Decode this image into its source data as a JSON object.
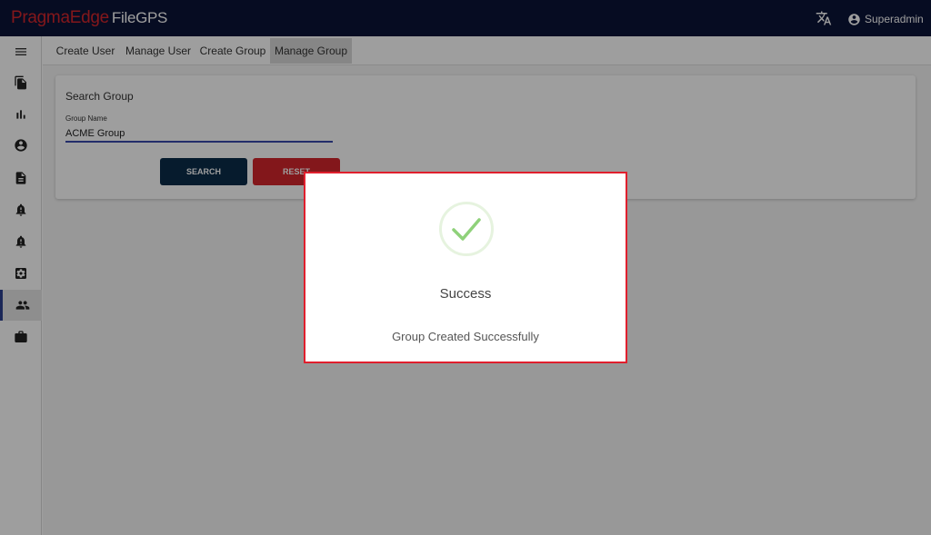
{
  "header": {
    "logo_brand": "PragmaEdge",
    "logo_product": "FileGPS",
    "translate_icon": "translate-icon",
    "user_icon": "account-circle-icon",
    "username": "Superadmin",
    "background": "#0b1437",
    "brand_color": "#d4262c"
  },
  "sidebar": {
    "items": [
      {
        "icon": "menu-icon",
        "active": false
      },
      {
        "icon": "files-icon",
        "active": false
      },
      {
        "icon": "bar-chart-icon",
        "active": false
      },
      {
        "icon": "account-circle-icon",
        "active": false
      },
      {
        "icon": "document-icon",
        "active": false
      },
      {
        "icon": "bell-alert-icon",
        "active": false
      },
      {
        "icon": "bell-alert-icon",
        "active": false
      },
      {
        "icon": "settings-box-icon",
        "active": false
      },
      {
        "icon": "group-icon",
        "active": true
      },
      {
        "icon": "briefcase-icon",
        "active": false
      }
    ]
  },
  "tabs": [
    {
      "label": "Create User",
      "active": false
    },
    {
      "label": "Manage User",
      "active": false
    },
    {
      "label": "Create Group",
      "active": false
    },
    {
      "label": "Manage Group",
      "active": true
    }
  ],
  "search_card": {
    "title": "Search Group",
    "field_label": "Group Name",
    "field_value": "ACME Group",
    "search_label": "SEARCH",
    "reset_label": "RESET",
    "search_color": "#0b2c4a",
    "reset_color": "#d4262c"
  },
  "dialog": {
    "icon": "check-circle-icon",
    "title": "Success",
    "message": "Group Created Successfully",
    "border_color": "#e01f2d",
    "check_color": "#8fd17a"
  }
}
